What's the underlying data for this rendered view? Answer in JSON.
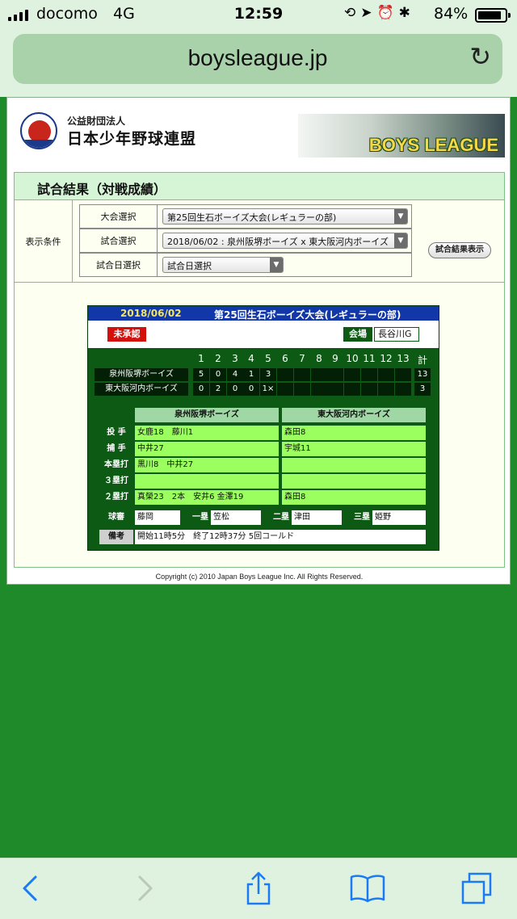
{
  "status_bar": {
    "carrier": "docomo",
    "network": "4G",
    "time": "12:59",
    "battery": "84%",
    "battery_level": 0.84,
    "icons": [
      "orientation-lock-icon",
      "location-icon",
      "alarm-icon",
      "bluetooth-icon"
    ]
  },
  "browser": {
    "url": "boysleague.jp"
  },
  "header": {
    "org_type": "公益財団法人",
    "org_name": "日本少年野球連盟",
    "banner": "BOYS LEAGUE"
  },
  "panel": {
    "title": "試合結果（対戦成績）",
    "conditions_label": "表示条件",
    "filters": [
      {
        "label": "大会選択",
        "value": "第25回生石ボーイズ大会(レギュラーの部)"
      },
      {
        "label": "試合選択",
        "value": "2018/06/02 : 泉州阪堺ボーイズ x 東大阪河内ボーイズ"
      },
      {
        "label": "試合日選択",
        "value": "試合日選択"
      }
    ],
    "show_button": "試合結果表示"
  },
  "game": {
    "date": "2018/06/02",
    "tournament": "第25回生石ボーイズ大会(レギュラーの部)",
    "status_badge": "未承認",
    "venue_label": "会場",
    "venue": "長谷川G",
    "innings": [
      "1",
      "2",
      "3",
      "4",
      "5",
      "6",
      "7",
      "8",
      "9",
      "10",
      "11",
      "12",
      "13",
      "計"
    ],
    "teams": [
      {
        "name": "泉州阪堺ボーイズ",
        "scores": [
          "5",
          "0",
          "4",
          "1",
          "3",
          "",
          "",
          "",
          "",
          "",
          "",
          "",
          ""
        ],
        "total": "13"
      },
      {
        "name": "東大阪河内ボーイズ",
        "scores": [
          "0",
          "2",
          "0",
          "0",
          "1×",
          "",
          "",
          "",
          "",
          "",
          "",
          "",
          ""
        ],
        "total": "3"
      }
    ],
    "details_header": [
      "泉州阪堺ボーイズ",
      "東大阪河内ボーイズ"
    ],
    "details": [
      {
        "label": "投 手",
        "home": "女鹿18　藤川1",
        "away": "森田8"
      },
      {
        "label": "捕 手",
        "home": "中井27",
        "away": "宇城11"
      },
      {
        "label": "本塁打",
        "home": "黒川8　中井27",
        "away": ""
      },
      {
        "label": "３塁打",
        "home": "",
        "away": ""
      },
      {
        "label": "２塁打",
        "home": "真榮23　2本　安井6 金澤19",
        "away": "森田8"
      }
    ],
    "umpires": [
      {
        "label": "球審",
        "name": "藤岡"
      },
      {
        "label": "一塁",
        "name": "笠松"
      },
      {
        "label": "二塁",
        "name": "津田"
      },
      {
        "label": "三塁",
        "name": "姫野"
      }
    ],
    "notes_label": "備考",
    "notes": "開始11時5分　終了12時37分  5回コールド"
  },
  "footer": {
    "copyright": "Copyright (c) 2010 Japan Boys League Inc. All Rights Reserved."
  },
  "toolbar": {
    "buttons": [
      "back-icon",
      "forward-icon",
      "share-icon",
      "bookmarks-icon",
      "tabs-icon"
    ]
  },
  "colors": {
    "page_green": "#1f8a2a",
    "card_green": "#0c5a13",
    "title_blue": "#1137a8",
    "cell_lime": "#9bff5f",
    "badge_red": "#d4100c",
    "ios_blue": "#1a7cf5"
  }
}
